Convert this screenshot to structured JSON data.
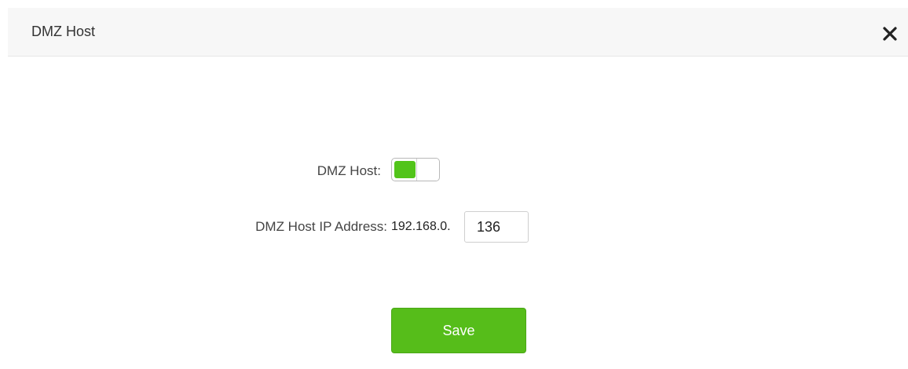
{
  "dialog": {
    "title": "DMZ Host",
    "close_icon": "close-icon"
  },
  "form": {
    "dmz_toggle": {
      "label": "DMZ Host:",
      "enabled": true,
      "accent_color": "#52c41a"
    },
    "ip_address": {
      "label": "DMZ Host IP Address:",
      "prefix": "192.168.0.",
      "value": "136"
    }
  },
  "actions": {
    "save_label": "Save",
    "save_color": "#56bd1a"
  }
}
